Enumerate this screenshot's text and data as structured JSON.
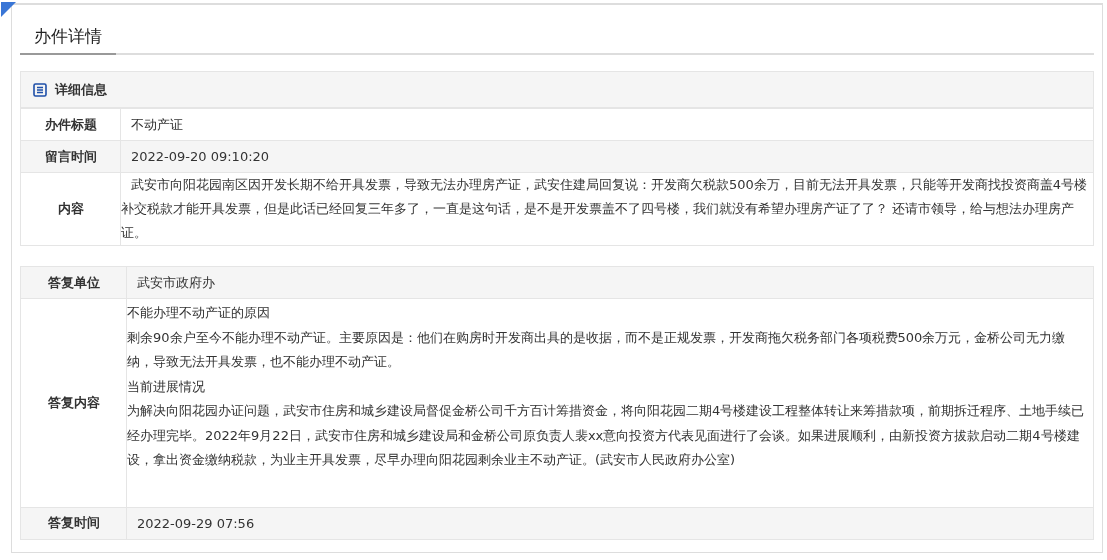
{
  "page_title": "办件详情",
  "detail": {
    "heading": "详细信息",
    "rows": [
      {
        "label": "办件标题",
        "value": "不动产证"
      },
      {
        "label": "留言时间",
        "value": "2022-09-20 09:10:20"
      },
      {
        "label": "内容",
        "value": "武安市向阳花园南区因开发长期不给开具发票，导致无法办理房产证，武安住建局回复说：开发商欠税款500余万，目前无法开具发票，只能等开发商找投资商盖4号楼补交税款才能开具发票，但是此话已经回复三年多了，一直是这句话，是不是开发票盖不了四号楼，我们就没有希望办理房产证了了？ 还请市领导，给与想法办理房产证。"
      }
    ]
  },
  "reply": {
    "unit_label": "答复单位",
    "unit": "武安市政府办",
    "content_label": "答复内容",
    "paragraphs": [
      "不能办理不动产证的原因",
      "剩余90余户至今不能办理不动产证。主要原因是：他们在购房时开发商出具的是收据，而不是正规发票，开发商拖欠税务部门各项税费500余万元，金桥公司无力缴纳，导致无法开具发票，也不能办理不动产证。",
      "当前进展情况",
      "为解决向阳花园办证问题，武安市住房和城乡建设局督促金桥公司千方百计筹措资金，将向阳花园二期4号楼建设工程整体转让来筹措款项，前期拆迁程序、土地手续已经办理完毕。2022年9月22日，武安市住房和城乡建设局和金桥公司原负责人裴xx意向投资方代表见面进行了会谈。如果进展顺利，由新投资方拔款启动二期4号楼建设，拿出资金缴纳税款，为业主开具发票，尽早办理向阳花园剩余业主不动产证。(武安市人民政府办公室)"
    ],
    "time_label": "答复时间",
    "time": "2022-09-29 07:56"
  }
}
